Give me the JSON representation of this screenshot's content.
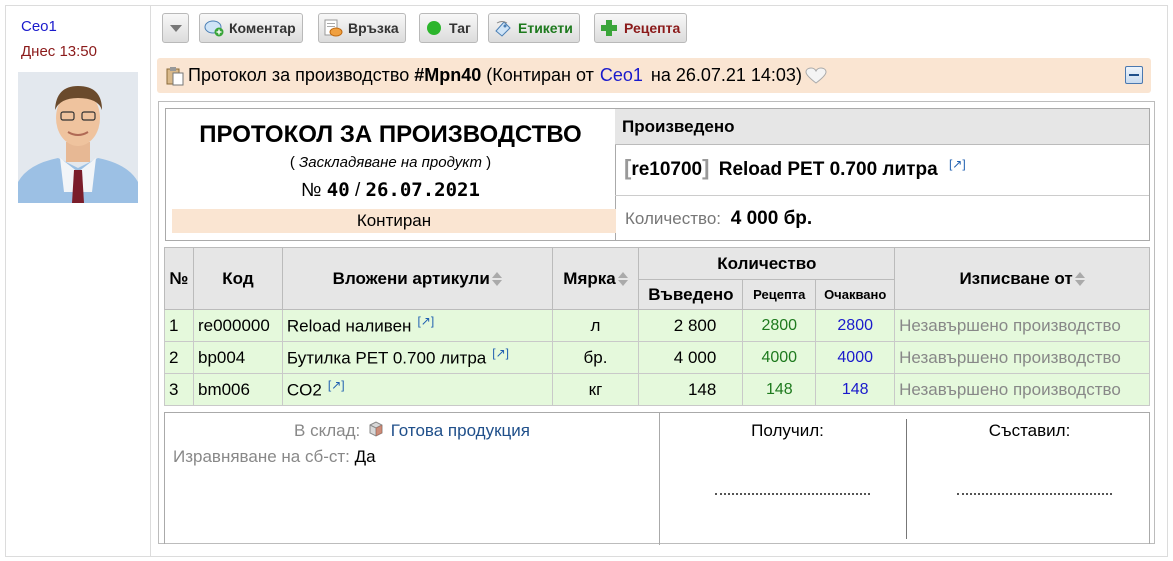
{
  "post": {
    "author": "Ceo1",
    "time": "Днес 13:50"
  },
  "toolbar": {
    "dropdown_icon": "chevron-down-icon",
    "buttons": [
      {
        "label": "Коментар",
        "icon": "comment-add-icon"
      },
      {
        "label": "Връзка",
        "icon": "link-icon"
      },
      {
        "label": "Таг",
        "icon": "tag-dot-icon"
      },
      {
        "label": "Етикети",
        "icon": "label-icon"
      },
      {
        "label": "Рецепта",
        "icon": "plus-icon"
      }
    ],
    "colors": {
      "tag": "#22aa22",
      "etiketi": "#1e7a1e",
      "recepta": "#8b1a1a"
    }
  },
  "header": {
    "prefix": "Протокол за производство",
    "code": "#Mpn40",
    "status_open": "(Контиран от",
    "author_link": "Ceo1",
    "date_text": "на 26.07.21 14:03)",
    "favorite_icon": "heart-outline-icon",
    "collapse_icon": "minus-icon",
    "bg": "#fae5d2"
  },
  "document": {
    "title": "ПРОТОКОЛ ЗА ПРОИЗВОДСТВО",
    "subtitle_open": "(",
    "subtitle": "Заскладяване на продукт",
    "subtitle_close": ")",
    "number_prefix": "№",
    "number": "40",
    "number_sep": "/",
    "date": "26.07.2021",
    "status": "Контиран"
  },
  "product": {
    "heading": "Произведено",
    "code": "re10700",
    "name": "Reload PET 0.700 литра",
    "qty_label": "Количество:",
    "qty_value": "4 000 бр."
  },
  "table": {
    "headers": {
      "num": "№",
      "code": "Код",
      "items": "Вложени артикули",
      "unit": "Мярка",
      "qty": "Количество",
      "entered": "Въведено",
      "recipe": "Рецепта",
      "expected": "Очаквано",
      "written_off": "Изписване от"
    },
    "rows": [
      {
        "n": "1",
        "code": "re000000",
        "name": "Reload наливен",
        "unit": "л",
        "entered": "2 800",
        "recipe": "2800",
        "expected": "2800",
        "from": "Незавършено производство"
      },
      {
        "n": "2",
        "code": "bp004",
        "name": "Бутилка PET 0.700 литра",
        "unit": "бр.",
        "entered": "4 000",
        "recipe": "4000",
        "expected": "4000",
        "from": "Незавършено производство"
      },
      {
        "n": "3",
        "code": "bm006",
        "name": "CO2",
        "unit": "кг",
        "entered": "148",
        "recipe": "148",
        "expected": "148",
        "from": "Незавършено производство"
      }
    ]
  },
  "footer": {
    "warehouse_label": "В склад:",
    "warehouse_icon": "box-icon",
    "warehouse_value": "Готова продукция",
    "cost_label": "Изравняване на сб-ст:",
    "cost_value": "Да",
    "received_label": "Получил:",
    "composed_label": "Съставил:"
  }
}
